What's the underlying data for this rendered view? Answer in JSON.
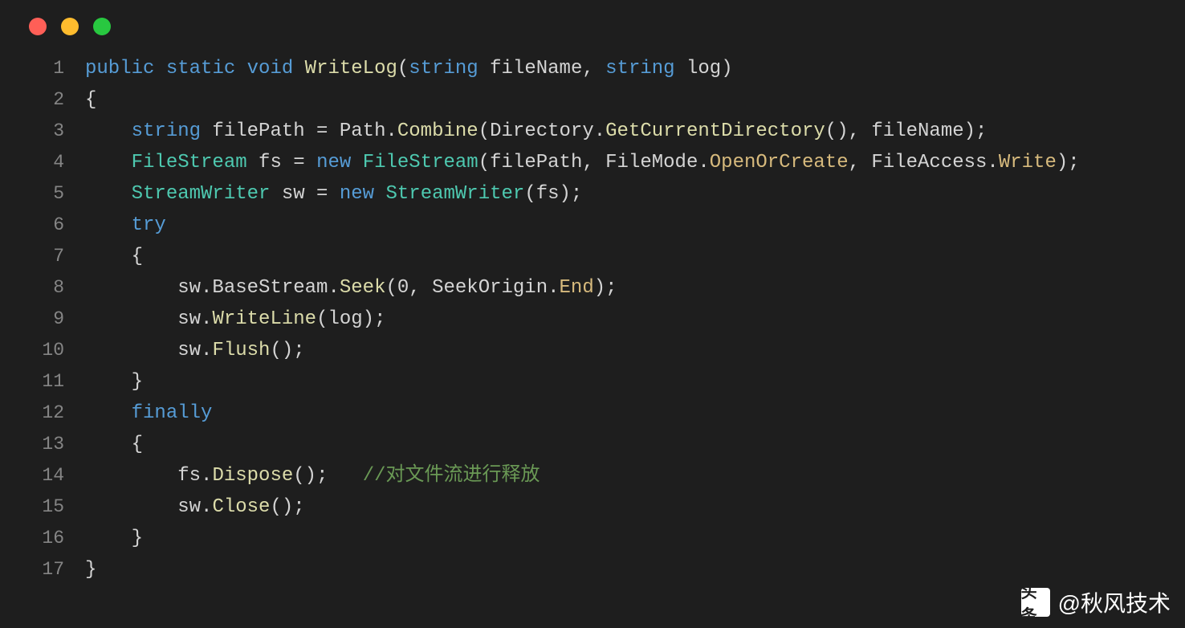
{
  "colors": {
    "background": "#1e1e1e",
    "keyword_blue": "#569cd6",
    "type_teal": "#4ec9b0",
    "method_yellow": "#dcdcaa",
    "variable_light": "#9cdcfe",
    "enum_orange": "#d7ba7d",
    "comment_green": "#6a9955",
    "text_default": "#d4d4d4",
    "line_number": "#858585"
  },
  "lines": {
    "1": {
      "num": "1"
    },
    "2": {
      "num": "2"
    },
    "3": {
      "num": "3"
    },
    "4": {
      "num": "4"
    },
    "5": {
      "num": "5"
    },
    "6": {
      "num": "6"
    },
    "7": {
      "num": "7"
    },
    "8": {
      "num": "8"
    },
    "9": {
      "num": "9"
    },
    "10": {
      "num": "10"
    },
    "11": {
      "num": "11"
    },
    "12": {
      "num": "12"
    },
    "13": {
      "num": "13"
    },
    "14": {
      "num": "14"
    },
    "15": {
      "num": "15"
    },
    "16": {
      "num": "16"
    },
    "17": {
      "num": "17"
    }
  },
  "tokens": {
    "public": "public",
    "static": "static",
    "void": "void",
    "WriteLog": "WriteLog",
    "openParen": "(",
    "string1": "string",
    "fileName1": " fileName, ",
    "string2": "string",
    "log": " log)",
    "brace_open1": "{",
    "indent1": "    ",
    "string3": "string",
    "filePath_decl": " filePath = Path.",
    "Combine": "Combine",
    "paren_open1": "(Directory.",
    "GetCurrentDirectory": "GetCurrentDirectory",
    "paren_close1": "(), fileName);",
    "FileStream1": "FileStream",
    "fs_decl": " fs = ",
    "new1": "new",
    "space1": " ",
    "FileStream2": "FileStream",
    "fs_args": "(filePath, FileMode.",
    "OpenOrCreate": "OpenOrCreate",
    "comma1": ", FileAccess.",
    "Write": "Write",
    "paren_close2": ");",
    "StreamWriter1": "StreamWriter",
    "sw_decl": " sw = ",
    "new2": "new",
    "StreamWriter2": "StreamWriter",
    "sw_args": "(fs);",
    "try": "try",
    "brace_open2": "    {",
    "indent2": "        ",
    "sw_base": "sw.BaseStream.",
    "Seek": "Seek",
    "seek_args": "(0, SeekOrigin.",
    "End": "End",
    "paren_close3": ");",
    "sw_write": "sw.",
    "WriteLine": "WriteLine",
    "write_args": "(log);",
    "sw_flush": "sw.",
    "Flush": "Flush",
    "flush_args": "();",
    "brace_close1": "    }",
    "finally": "finally",
    "brace_open3": "    {",
    "fs_disp": "fs.",
    "Dispose": "Dispose",
    "disp_args": "();   ",
    "comment": "//对文件流进行释放",
    "sw_close": "sw.",
    "Close": "Close",
    "close_args": "();",
    "brace_close2": "    }",
    "brace_close3": "}"
  },
  "watermark": {
    "icon": "头条",
    "text": "@秋风技术"
  }
}
